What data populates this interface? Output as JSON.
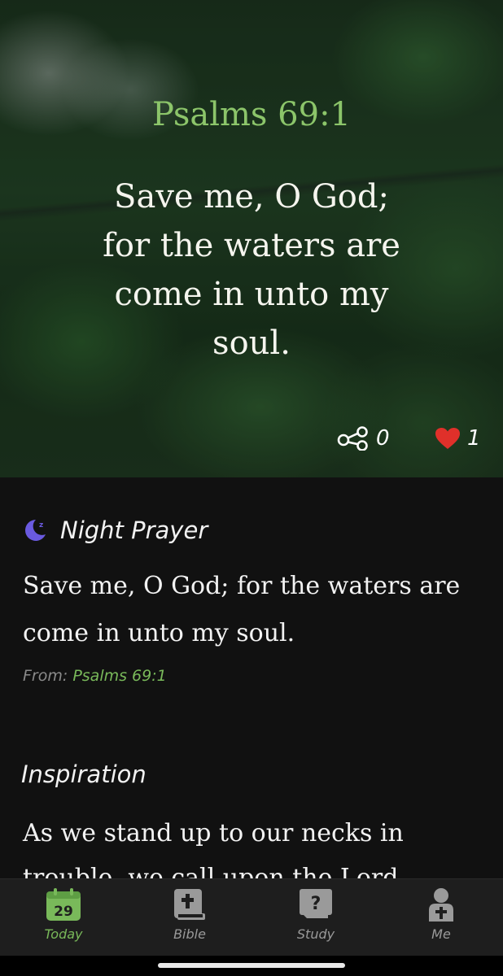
{
  "hero": {
    "verse_reference": "Psalms 69:1",
    "verse_text": "Save me, O God; for the waters are come in unto my soul.",
    "share_count": "0",
    "like_count": "1"
  },
  "night_prayer": {
    "title": "Night Prayer",
    "text": "Save me, O God; for the waters are come in unto my soul.",
    "from_label": "From:",
    "from_reference": "Psalms 69:1"
  },
  "inspiration": {
    "title": "Inspiration",
    "text": "As we stand up to our necks in trouble, we call upon the Lord"
  },
  "bottom_nav": {
    "items": [
      {
        "label": "Today",
        "icon": "calendar-icon",
        "badge": "29",
        "active": true
      },
      {
        "label": "Bible",
        "icon": "bible-icon",
        "active": false
      },
      {
        "label": "Study",
        "icon": "question-book-icon",
        "active": false
      },
      {
        "label": "Me",
        "icon": "person-icon",
        "active": false
      }
    ]
  },
  "colors": {
    "accent_green": "#79b95a",
    "heart_red": "#e0302a",
    "moon_purple": "#6a5ae0",
    "background": "#111111"
  }
}
